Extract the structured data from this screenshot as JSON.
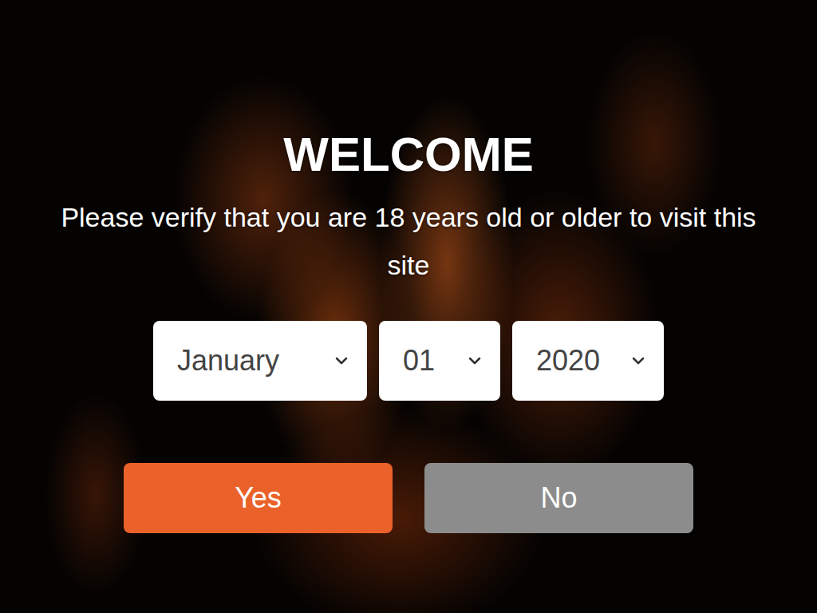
{
  "title": "WELCOME",
  "message": "Please verify that you are 18 years old or older to visit this site",
  "dropdowns": [
    {
      "label": "January"
    },
    {
      "label": "01"
    },
    {
      "label": "2020"
    }
  ],
  "buttons": [
    "Yes",
    "No"
  ]
}
